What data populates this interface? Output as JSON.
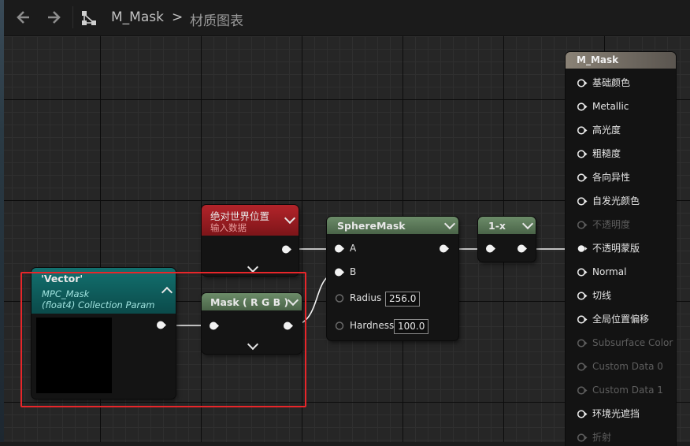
{
  "toolbar": {
    "back_icon": "arrow-left-icon",
    "forward_icon": "arrow-right-icon",
    "graph_icon": "material-graph-icon",
    "breadcrumb_asset": "M_Mask",
    "breadcrumb_separator": ">",
    "breadcrumb_page": "材质图表"
  },
  "nodes": {
    "vector": {
      "title": "'Vector'",
      "sub1": "MPC_Mask",
      "sub2": "(float4) Collection Param",
      "preview_color": "#000000"
    },
    "abs_world_pos": {
      "title": "绝对世界位置",
      "subtitle": "输入数据"
    },
    "mask_rgb": {
      "title": "Mask ( R G B )"
    },
    "sphere_mask": {
      "title": "SphereMask",
      "pin_a": "A",
      "pin_b": "B",
      "radius_label": "Radius",
      "radius_value": "256.0",
      "hardness_label": "Hardness",
      "hardness_value": "100.0"
    },
    "one_minus_x": {
      "title": "1-x"
    }
  },
  "material_node": {
    "title": "M_Mask",
    "inputs": [
      {
        "label": "基础颜色",
        "enabled": true
      },
      {
        "label": "Metallic",
        "enabled": true
      },
      {
        "label": "高光度",
        "enabled": true
      },
      {
        "label": "粗糙度",
        "enabled": true
      },
      {
        "label": "各向异性",
        "enabled": true
      },
      {
        "label": "自发光颜色",
        "enabled": true
      },
      {
        "label": "不透明度",
        "enabled": false
      },
      {
        "label": "不透明蒙版",
        "enabled": true,
        "connected": true
      },
      {
        "label": "Normal",
        "enabled": true
      },
      {
        "label": "切线",
        "enabled": true
      },
      {
        "label": "全局位置偏移",
        "enabled": true
      },
      {
        "label": "Subsurface Color",
        "enabled": false
      },
      {
        "label": "Custom Data 0",
        "enabled": false
      },
      {
        "label": "Custom Data 1",
        "enabled": false
      },
      {
        "label": "环境光遮挡",
        "enabled": true
      },
      {
        "label": "折射",
        "enabled": false
      }
    ]
  },
  "colors": {
    "canvas_bg": "#262626",
    "vector_header": "#0e5a5a",
    "input_data_header": "#a51d1d",
    "function_header": "#5a7a58",
    "material_header": "#8a8276",
    "selection_outline": "#e8262a"
  }
}
